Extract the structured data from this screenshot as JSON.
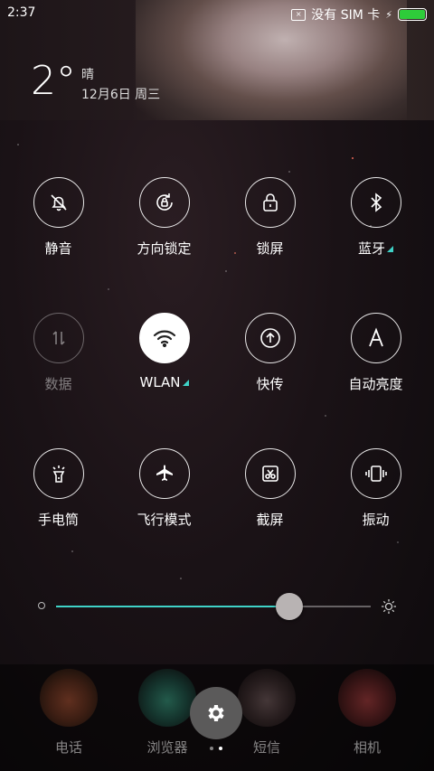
{
  "status_bar": {
    "time": "2:37",
    "carrier": "没有 SIM 卡",
    "battery_color": "#2ecc3a"
  },
  "weather": {
    "temperature": "2°",
    "condition": "晴",
    "date": "12月6日 周三"
  },
  "toggles": [
    {
      "label": "静音",
      "icon": "bell-off-icon",
      "state": "off"
    },
    {
      "label": "方向锁定",
      "icon": "rotation-lock-icon",
      "state": "off"
    },
    {
      "label": "锁屏",
      "icon": "lock-icon",
      "state": "off"
    },
    {
      "label": "蓝牙",
      "icon": "bluetooth-icon",
      "state": "off",
      "has_menu": true
    },
    {
      "label": "数据",
      "icon": "data-arrows-icon",
      "state": "disabled"
    },
    {
      "label": "WLAN",
      "icon": "wifi-icon",
      "state": "on",
      "has_menu": true
    },
    {
      "label": "快传",
      "icon": "transfer-icon",
      "state": "off"
    },
    {
      "label": "自动亮度",
      "icon": "auto-brightness-icon",
      "state": "off"
    },
    {
      "label": "手电筒",
      "icon": "flashlight-icon",
      "state": "off"
    },
    {
      "label": "飞行模式",
      "icon": "airplane-icon",
      "state": "off"
    },
    {
      "label": "截屏",
      "icon": "screenshot-icon",
      "state": "off"
    },
    {
      "label": "振动",
      "icon": "vibrate-icon",
      "state": "off"
    }
  ],
  "brightness": {
    "level_percent": 74,
    "accent": "#3fd2c7"
  },
  "dock": {
    "apps": [
      {
        "label": "电话"
      },
      {
        "label": "浏览器"
      },
      {
        "label": "短信"
      },
      {
        "label": "相机"
      }
    ],
    "settings_icon": "gear-icon",
    "page_indicator": {
      "pages": 2,
      "current": 2
    }
  }
}
